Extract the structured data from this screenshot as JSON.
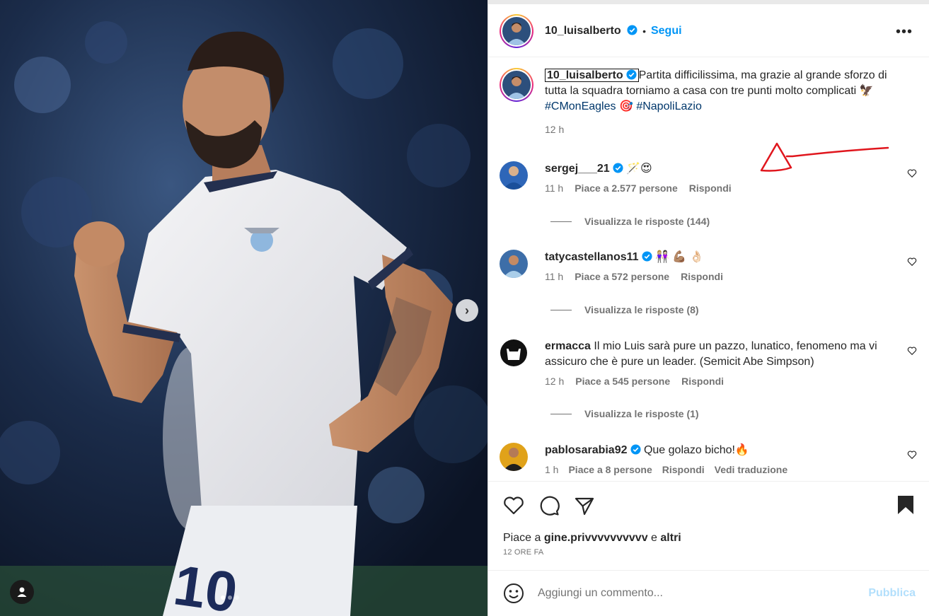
{
  "post": {
    "username": "10_luisalberto",
    "follow_label": "Segui",
    "separator": "•",
    "more_label": "•••"
  },
  "caption": {
    "author": "10_luisalberto",
    "text": "Partita difficilissima, ma grazie al grande sforzo di tutta la squadra torniamo a casa con tre punti molto complicati 🦅",
    "hashtag1": "#CMonEagles",
    "emoji_mid": "🎯",
    "hashtag2": "#NapoliLazio",
    "time": "12 h"
  },
  "comments": [
    {
      "user": "sergej___21",
      "verified": true,
      "text": "🪄😍",
      "time": "11 h",
      "likes": "Piace a 2.577 persone",
      "reply": "Rispondi",
      "view_replies": "Visualizza le risposte (144)"
    },
    {
      "user": "tatycastellanos11",
      "verified": true,
      "text": "👩🏼‍🤝‍👩🏻 💪🏽 👌🏻",
      "time": "11 h",
      "likes": "Piace a 572 persone",
      "reply": "Rispondi",
      "view_replies": "Visualizza le risposte (8)"
    },
    {
      "user": "ermacca",
      "verified": false,
      "text": "Il mio Luis sarà pure un pazzo, lunatico, fenomeno ma vi assicuro che è pure un leader. (Semicit Abe Simpson)",
      "time": "12 h",
      "likes": "Piace a 545 persone",
      "reply": "Rispondi",
      "view_replies": "Visualizza le risposte (1)"
    },
    {
      "user": "pablosarabia92",
      "verified": true,
      "text": "Que golazo bicho!🔥",
      "time": "1 h",
      "likes": "Piace a 8 persone",
      "reply": "Rispondi",
      "translate": "Vedi traduzione"
    }
  ],
  "likes_line": {
    "prefix": "Piace a",
    "user": "gine.privvvvvvvvvv",
    "middle": "e",
    "others": "altri"
  },
  "post_age": "12 ORE FA",
  "add_comment": {
    "placeholder": "Aggiungi un commento...",
    "publish_label": "Pubblica"
  },
  "photo": {
    "jersey_number": "10"
  },
  "colors": {
    "link_blue": "#0095f6",
    "hashtag_blue": "#00376b",
    "annotation_red": "#e0161d",
    "publish_disabled": "#b2dffc"
  }
}
